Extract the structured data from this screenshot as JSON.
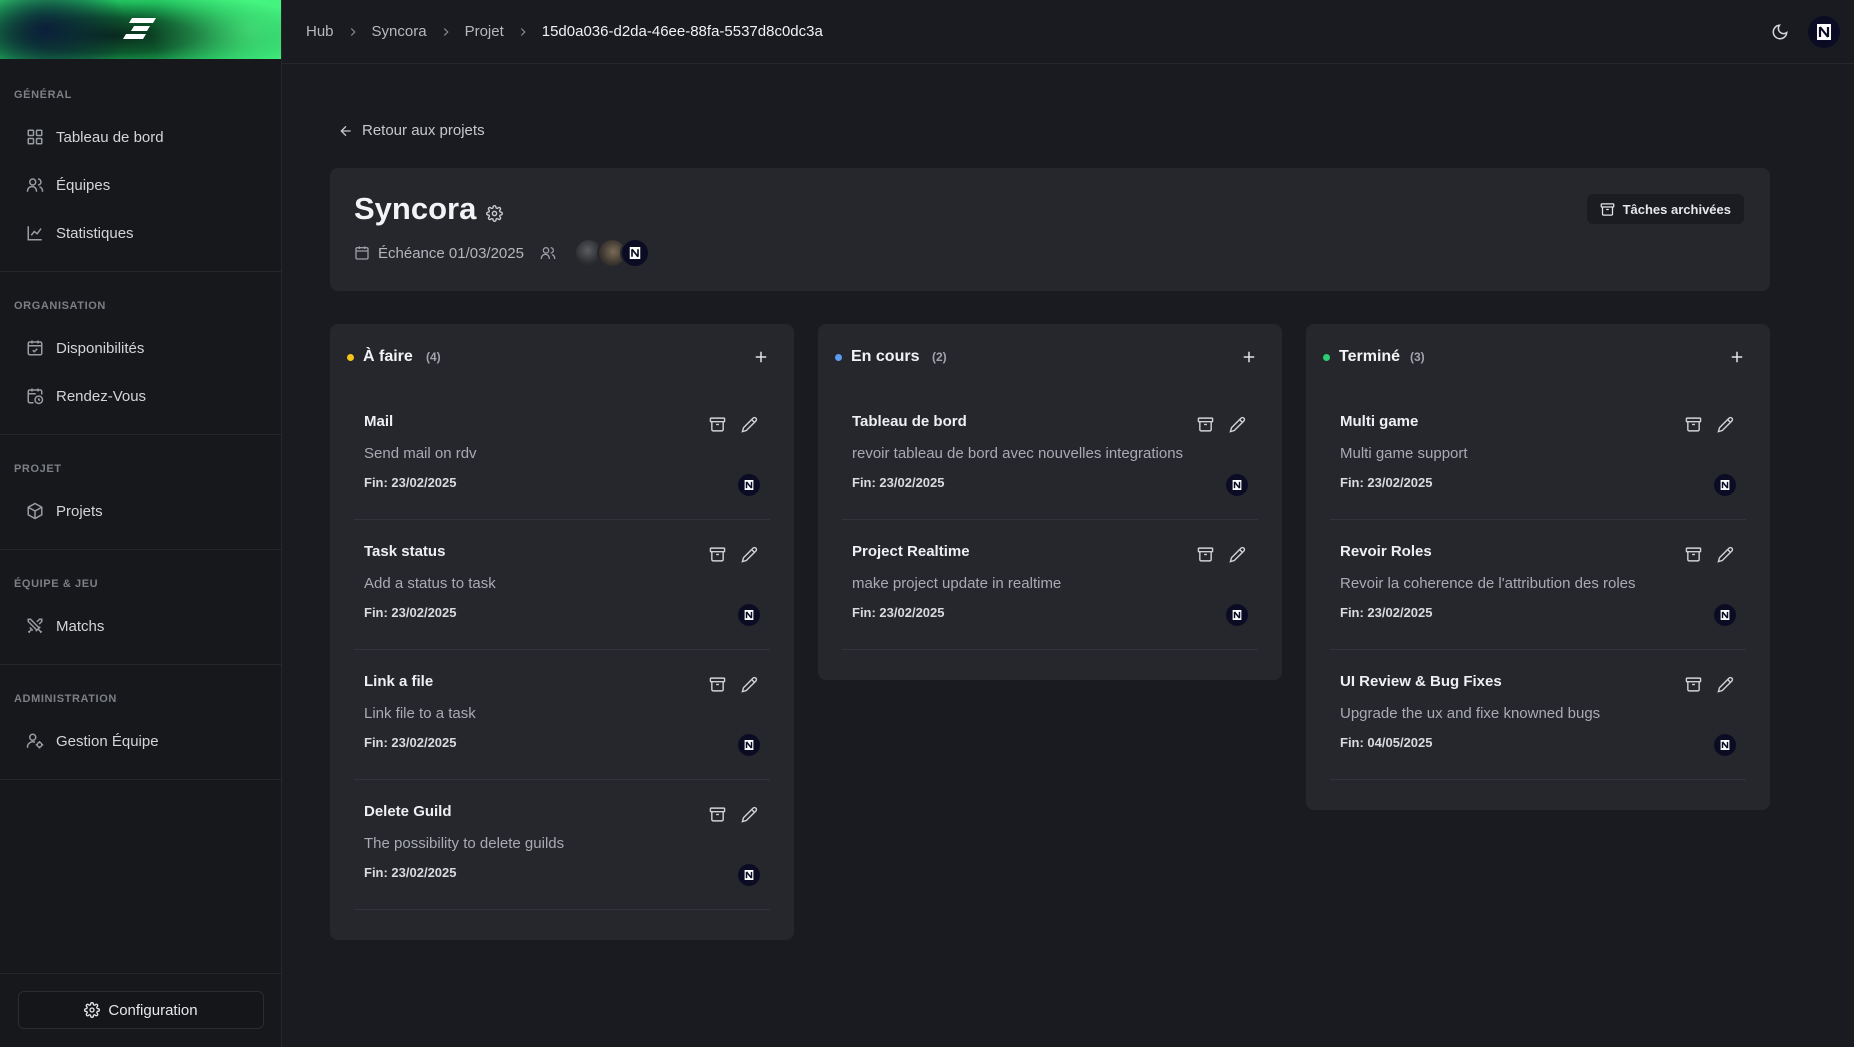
{
  "breadcrumb": [
    "Hub",
    "Syncora",
    "Projet",
    "15d0a036-d2da-46ee-88fa-5537d8c0dc3a"
  ],
  "sidebar": {
    "sections": [
      {
        "heading": "GÉNÉRAL",
        "items": [
          {
            "label": "Tableau de bord",
            "icon": "dashboard-icon"
          },
          {
            "label": "Équipes",
            "icon": "users-icon"
          },
          {
            "label": "Statistiques",
            "icon": "chart-icon"
          }
        ]
      },
      {
        "heading": "ORGANISATION",
        "items": [
          {
            "label": "Disponibilités",
            "icon": "calendar-check-icon"
          },
          {
            "label": "Rendez-Vous",
            "icon": "calendar-clock-icon"
          }
        ]
      },
      {
        "heading": "PROJET",
        "items": [
          {
            "label": "Projets",
            "icon": "package-icon"
          }
        ]
      },
      {
        "heading": "ÉQUIPE & JEU",
        "items": [
          {
            "label": "Matchs",
            "icon": "swords-icon"
          }
        ]
      },
      {
        "heading": "ADMINISTRATION",
        "items": [
          {
            "label": "Gestion Équipe",
            "icon": "user-cog-icon"
          }
        ]
      }
    ],
    "config_label": "Configuration"
  },
  "back_label": "Retour aux projets",
  "project": {
    "title": "Syncora",
    "deadline": "Échéance 01/03/2025",
    "archived_label": "Tâches archivées"
  },
  "columns": [
    {
      "title": "À faire",
      "count": "(4)",
      "dot_color": "#f5c518",
      "tasks": [
        {
          "title": "Mail",
          "desc": "Send mail on rdv",
          "fin": "Fin: 23/02/2025"
        },
        {
          "title": "Task status",
          "desc": "Add a status to task",
          "fin": "Fin: 23/02/2025"
        },
        {
          "title": "Link a file",
          "desc": "Link file to a task",
          "fin": "Fin: 23/02/2025"
        },
        {
          "title": "Delete Guild",
          "desc": "The possibility to delete guilds",
          "fin": "Fin: 23/02/2025"
        }
      ]
    },
    {
      "title": "En cours",
      "count": "(2)",
      "dot_color": "#5b9cf0",
      "tasks": [
        {
          "title": "Tableau de bord",
          "desc": "revoir tableau de bord avec nouvelles integrations",
          "fin": "Fin: 23/02/2025"
        },
        {
          "title": "Project Realtime",
          "desc": "make project update in realtime",
          "fin": "Fin: 23/02/2025"
        }
      ]
    },
    {
      "title": "Terminé",
      "count": "(3)",
      "dot_color": "#2ecc71",
      "tasks": [
        {
          "title": "Multi game",
          "desc": "Multi game support",
          "fin": "Fin: 23/02/2025"
        },
        {
          "title": "Revoir Roles",
          "desc": "Revoir la coherence de l'attribution des roles",
          "fin": "Fin: 23/02/2025"
        },
        {
          "title": "UI Review & Bug Fixes",
          "desc": "Upgrade the ux and fixe knowned bugs",
          "fin": "Fin: 04/05/2025"
        }
      ]
    }
  ]
}
